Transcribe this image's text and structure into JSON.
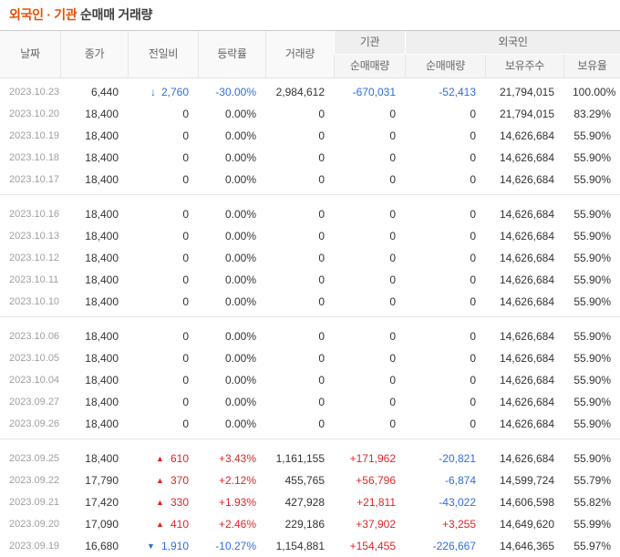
{
  "title": {
    "highlight": "외국인 · 기관",
    "rest": " 순매매 거래량"
  },
  "colors": {
    "accent": "#eb4e00",
    "up": "#e02525",
    "down": "#2e6de0"
  },
  "table": {
    "groups": {
      "institution": "기관",
      "foreign": "외국인"
    },
    "columns": {
      "date": "날짜",
      "close": "종가",
      "change": "전일비",
      "rate": "등락률",
      "volume": "거래량",
      "inst_net": "순매매량",
      "frgn_net": "순매매량",
      "frgn_shares": "보유주수",
      "frgn_ratio": "보유율"
    }
  },
  "blocks": [
    [
      {
        "date": "2023.10.23",
        "close": "6,440",
        "arrow": "↓",
        "arrow_kind": "limit-down",
        "change": "2,760",
        "change_dir": "down",
        "rate": "-30.00%",
        "rate_dir": "down",
        "volume": "2,984,612",
        "inst_net": "-670,031",
        "inst_dir": "down",
        "frgn_net": "-52,413",
        "frgn_dir": "down",
        "shares": "21,794,015",
        "ratio": "100.00%"
      },
      {
        "date": "2023.10.20",
        "close": "18,400",
        "arrow": "",
        "arrow_kind": "none",
        "change": "0",
        "change_dir": "flat",
        "rate": "0.00%",
        "rate_dir": "flat",
        "volume": "0",
        "inst_net": "0",
        "inst_dir": "flat",
        "frgn_net": "0",
        "frgn_dir": "flat",
        "shares": "21,794,015",
        "ratio": "83.29%"
      },
      {
        "date": "2023.10.19",
        "close": "18,400",
        "arrow": "",
        "arrow_kind": "none",
        "change": "0",
        "change_dir": "flat",
        "rate": "0.00%",
        "rate_dir": "flat",
        "volume": "0",
        "inst_net": "0",
        "inst_dir": "flat",
        "frgn_net": "0",
        "frgn_dir": "flat",
        "shares": "14,626,684",
        "ratio": "55.90%"
      },
      {
        "date": "2023.10.18",
        "close": "18,400",
        "arrow": "",
        "arrow_kind": "none",
        "change": "0",
        "change_dir": "flat",
        "rate": "0.00%",
        "rate_dir": "flat",
        "volume": "0",
        "inst_net": "0",
        "inst_dir": "flat",
        "frgn_net": "0",
        "frgn_dir": "flat",
        "shares": "14,626,684",
        "ratio": "55.90%"
      },
      {
        "date": "2023.10.17",
        "close": "18,400",
        "arrow": "",
        "arrow_kind": "none",
        "change": "0",
        "change_dir": "flat",
        "rate": "0.00%",
        "rate_dir": "flat",
        "volume": "0",
        "inst_net": "0",
        "inst_dir": "flat",
        "frgn_net": "0",
        "frgn_dir": "flat",
        "shares": "14,626,684",
        "ratio": "55.90%"
      }
    ],
    [
      {
        "date": "2023.10.16",
        "close": "18,400",
        "arrow": "",
        "arrow_kind": "none",
        "change": "0",
        "change_dir": "flat",
        "rate": "0.00%",
        "rate_dir": "flat",
        "volume": "0",
        "inst_net": "0",
        "inst_dir": "flat",
        "frgn_net": "0",
        "frgn_dir": "flat",
        "shares": "14,626,684",
        "ratio": "55.90%"
      },
      {
        "date": "2023.10.13",
        "close": "18,400",
        "arrow": "",
        "arrow_kind": "none",
        "change": "0",
        "change_dir": "flat",
        "rate": "0.00%",
        "rate_dir": "flat",
        "volume": "0",
        "inst_net": "0",
        "inst_dir": "flat",
        "frgn_net": "0",
        "frgn_dir": "flat",
        "shares": "14,626,684",
        "ratio": "55.90%"
      },
      {
        "date": "2023.10.12",
        "close": "18,400",
        "arrow": "",
        "arrow_kind": "none",
        "change": "0",
        "change_dir": "flat",
        "rate": "0.00%",
        "rate_dir": "flat",
        "volume": "0",
        "inst_net": "0",
        "inst_dir": "flat",
        "frgn_net": "0",
        "frgn_dir": "flat",
        "shares": "14,626,684",
        "ratio": "55.90%"
      },
      {
        "date": "2023.10.11",
        "close": "18,400",
        "arrow": "",
        "arrow_kind": "none",
        "change": "0",
        "change_dir": "flat",
        "rate": "0.00%",
        "rate_dir": "flat",
        "volume": "0",
        "inst_net": "0",
        "inst_dir": "flat",
        "frgn_net": "0",
        "frgn_dir": "flat",
        "shares": "14,626,684",
        "ratio": "55.90%"
      },
      {
        "date": "2023.10.10",
        "close": "18,400",
        "arrow": "",
        "arrow_kind": "none",
        "change": "0",
        "change_dir": "flat",
        "rate": "0.00%",
        "rate_dir": "flat",
        "volume": "0",
        "inst_net": "0",
        "inst_dir": "flat",
        "frgn_net": "0",
        "frgn_dir": "flat",
        "shares": "14,626,684",
        "ratio": "55.90%"
      }
    ],
    [
      {
        "date": "2023.10.06",
        "close": "18,400",
        "arrow": "",
        "arrow_kind": "none",
        "change": "0",
        "change_dir": "flat",
        "rate": "0.00%",
        "rate_dir": "flat",
        "volume": "0",
        "inst_net": "0",
        "inst_dir": "flat",
        "frgn_net": "0",
        "frgn_dir": "flat",
        "shares": "14,626,684",
        "ratio": "55.90%"
      },
      {
        "date": "2023.10.05",
        "close": "18,400",
        "arrow": "",
        "arrow_kind": "none",
        "change": "0",
        "change_dir": "flat",
        "rate": "0.00%",
        "rate_dir": "flat",
        "volume": "0",
        "inst_net": "0",
        "inst_dir": "flat",
        "frgn_net": "0",
        "frgn_dir": "flat",
        "shares": "14,626,684",
        "ratio": "55.90%"
      },
      {
        "date": "2023.10.04",
        "close": "18,400",
        "arrow": "",
        "arrow_kind": "none",
        "change": "0",
        "change_dir": "flat",
        "rate": "0.00%",
        "rate_dir": "flat",
        "volume": "0",
        "inst_net": "0",
        "inst_dir": "flat",
        "frgn_net": "0",
        "frgn_dir": "flat",
        "shares": "14,626,684",
        "ratio": "55.90%"
      },
      {
        "date": "2023.09.27",
        "close": "18,400",
        "arrow": "",
        "arrow_kind": "none",
        "change": "0",
        "change_dir": "flat",
        "rate": "0.00%",
        "rate_dir": "flat",
        "volume": "0",
        "inst_net": "0",
        "inst_dir": "flat",
        "frgn_net": "0",
        "frgn_dir": "flat",
        "shares": "14,626,684",
        "ratio": "55.90%"
      },
      {
        "date": "2023.09.26",
        "close": "18,400",
        "arrow": "",
        "arrow_kind": "none",
        "change": "0",
        "change_dir": "flat",
        "rate": "0.00%",
        "rate_dir": "flat",
        "volume": "0",
        "inst_net": "0",
        "inst_dir": "flat",
        "frgn_net": "0",
        "frgn_dir": "flat",
        "shares": "14,626,684",
        "ratio": "55.90%"
      }
    ],
    [
      {
        "date": "2023.09.25",
        "close": "18,400",
        "arrow": "▲",
        "arrow_kind": "up",
        "change": "610",
        "change_dir": "up",
        "rate": "+3.43%",
        "rate_dir": "up",
        "volume": "1,161,155",
        "inst_net": "+171,962",
        "inst_dir": "up",
        "frgn_net": "-20,821",
        "frgn_dir": "down",
        "shares": "14,626,684",
        "ratio": "55.90%"
      },
      {
        "date": "2023.09.22",
        "close": "17,790",
        "arrow": "▲",
        "arrow_kind": "up",
        "change": "370",
        "change_dir": "up",
        "rate": "+2.12%",
        "rate_dir": "up",
        "volume": "455,765",
        "inst_net": "+56,796",
        "inst_dir": "up",
        "frgn_net": "-6,874",
        "frgn_dir": "down",
        "shares": "14,599,724",
        "ratio": "55.79%"
      },
      {
        "date": "2023.09.21",
        "close": "17,420",
        "arrow": "▲",
        "arrow_kind": "up",
        "change": "330",
        "change_dir": "up",
        "rate": "+1.93%",
        "rate_dir": "up",
        "volume": "427,928",
        "inst_net": "+21,811",
        "inst_dir": "up",
        "frgn_net": "-43,022",
        "frgn_dir": "down",
        "shares": "14,606,598",
        "ratio": "55.82%"
      },
      {
        "date": "2023.09.20",
        "close": "17,090",
        "arrow": "▲",
        "arrow_kind": "up",
        "change": "410",
        "change_dir": "up",
        "rate": "+2.46%",
        "rate_dir": "up",
        "volume": "229,186",
        "inst_net": "+37,902",
        "inst_dir": "up",
        "frgn_net": "+3,255",
        "frgn_dir": "up",
        "shares": "14,649,620",
        "ratio": "55.99%"
      },
      {
        "date": "2023.09.19",
        "close": "16,680",
        "arrow": "▼",
        "arrow_kind": "down",
        "change": "1,910",
        "change_dir": "down",
        "rate": "-10.27%",
        "rate_dir": "down",
        "volume": "1,154,881",
        "inst_net": "+154,455",
        "inst_dir": "up",
        "frgn_net": "-226,667",
        "frgn_dir": "down",
        "shares": "14,646,365",
        "ratio": "55.97%"
      }
    ]
  ]
}
